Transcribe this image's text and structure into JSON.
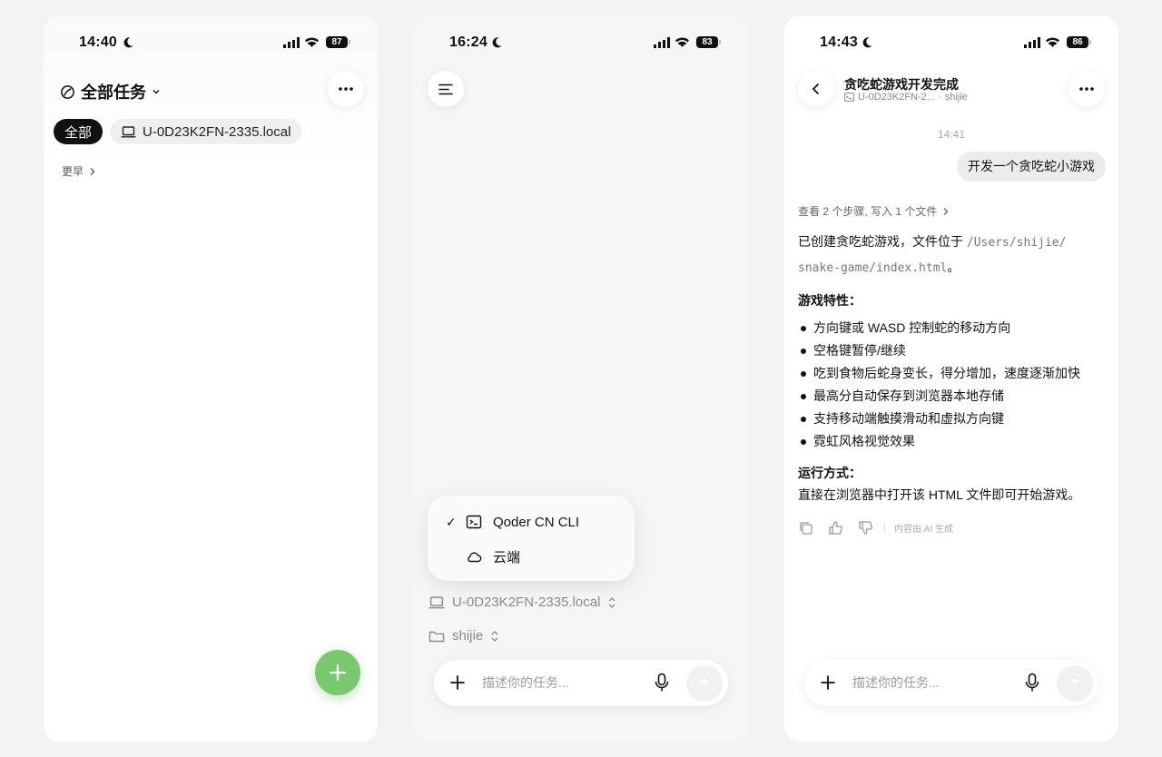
{
  "phone1": {
    "status": {
      "time": "14:40",
      "battery": "87"
    },
    "title": "全部任务",
    "filters": [
      {
        "label": "全部"
      },
      {
        "label": "U-0D23K2FN-2335.local"
      }
    ],
    "section_label": "更早"
  },
  "phone2": {
    "status": {
      "time": "16:24",
      "battery": "83"
    },
    "runtime_menu": {
      "options": [
        {
          "label": "Qoder CN CLI",
          "selected": true,
          "icon": "terminal-icon"
        },
        {
          "label": "云端",
          "selected": false,
          "icon": "cloud-icon"
        }
      ]
    },
    "device": "U-0D23K2FN-2335.local",
    "folder": "shijie",
    "composer_placeholder": "描述你的任务..."
  },
  "phone3": {
    "status": {
      "time": "14:43",
      "battery": "86"
    },
    "header": {
      "title": "贪吃蛇游戏开发完成",
      "device": "U-0D23K2FN-2...",
      "folder": "· shijie"
    },
    "message_time": "14:41",
    "user_message": "开发一个贪吃蛇小游戏",
    "steps_summary": "查看 2 个步骤, 写入 1 个文件",
    "reply": {
      "intro_text": "已创建贪吃蛇游戏，文件位于",
      "path_line1": "/Users/shijie/",
      "path_line2": "snake-game/index.html",
      "path_end": "。",
      "features_title": "游戏特性：",
      "features": [
        "方向键或 WASD 控制蛇的移动方向",
        "空格键暂停/继续",
        "吃到食物后蛇身变长，得分增加，速度逐渐加快",
        "最高分自动保存到浏览器本地存储",
        "支持移动端触摸滑动和虚拟方向键",
        "霓虹风格视觉效果"
      ],
      "run_title": "运行方式：",
      "run_text": "直接在浏览器中打开该 HTML 文件即可开始游戏。"
    },
    "ai_note": "内容由 AI 生成",
    "composer_placeholder": "描述你的任务..."
  },
  "colors": {
    "fab_green": "#78c86e",
    "active_chip": "#111111"
  }
}
